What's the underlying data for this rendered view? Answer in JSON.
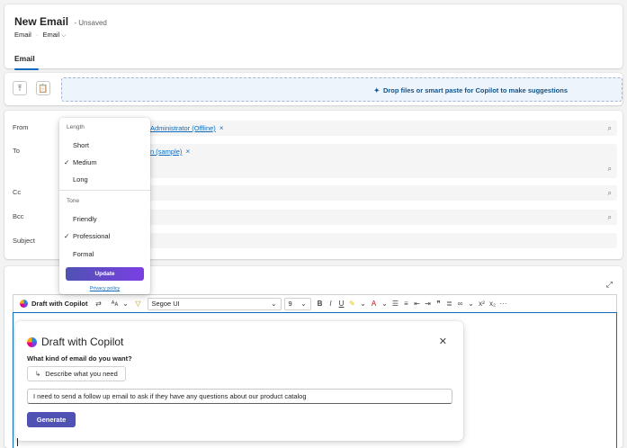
{
  "header": {
    "title": "New Email",
    "status": "- Unsaved",
    "breadcrumb": [
      "Email",
      "Email"
    ],
    "tab": "Email"
  },
  "toolbar": {
    "drop_text": "Drop files or smart paste for Copilot to make suggestions"
  },
  "fields": {
    "from_label": "From",
    "from_value": "Administrator (Offline)",
    "to_label": "To",
    "to_value": "n (sample)",
    "cc_label": "Cc",
    "bcc_label": "Bcc",
    "subject_label": "Subject"
  },
  "menu": {
    "length_label": "Length",
    "length_options": [
      "Short",
      "Medium",
      "Long"
    ],
    "length_selected": "Medium",
    "tone_label": "Tone",
    "tone_options": [
      "Friendly",
      "Professional",
      "Formal"
    ],
    "tone_selected": "Professional",
    "update_label": "Update",
    "privacy_label": "Privacy policy"
  },
  "editor": {
    "draft_label": "Draft with Copilot",
    "font_name": "Segoe UI",
    "font_size": "9"
  },
  "draft_panel": {
    "title": "Draft with Copilot",
    "question": "What kind of email do you want?",
    "describe_label": "Describe what you need",
    "prompt_value": "I need to send a follow up email to ask if they have any questions about our product catalog",
    "generate_label": "Generate"
  },
  "colors": {
    "accent": "#0f6cbd",
    "primary_button": "#4f52b2"
  }
}
